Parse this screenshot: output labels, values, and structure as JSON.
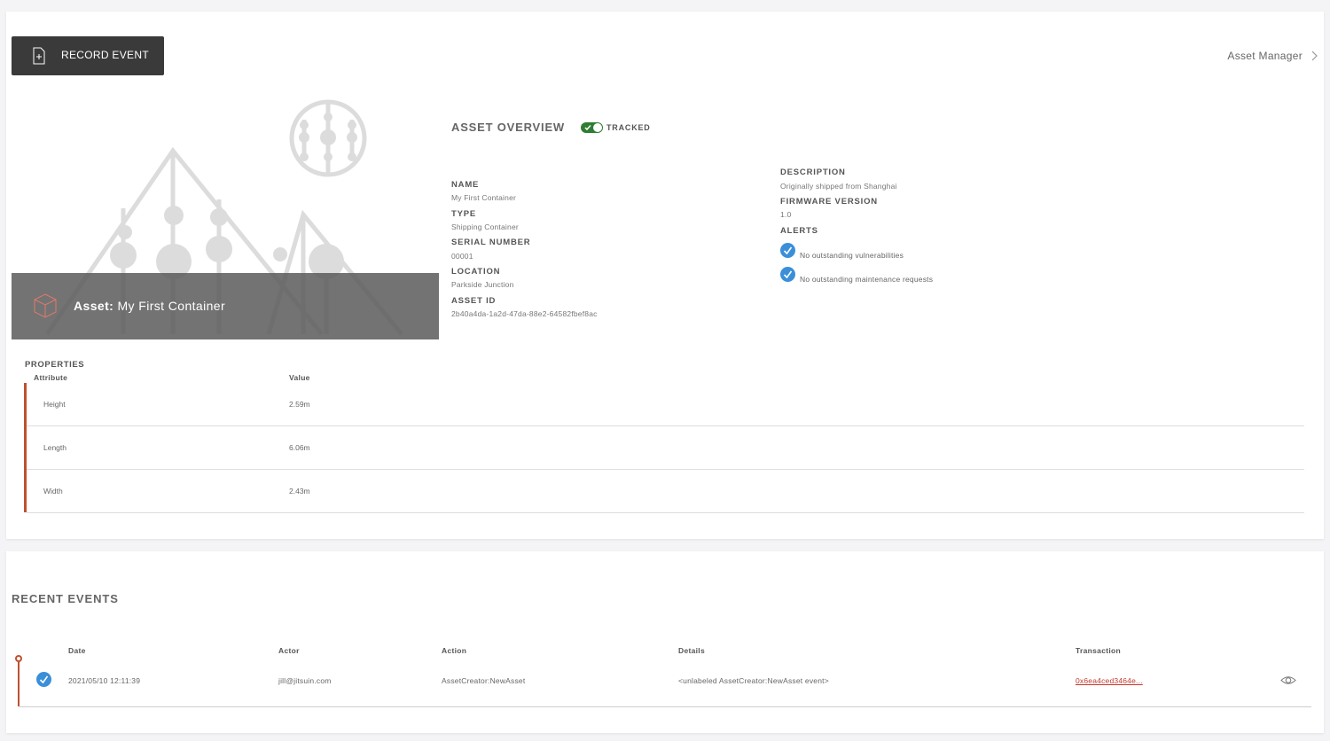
{
  "toolbar": {
    "record_label": "RECORD EVENT"
  },
  "breadcrumb": {
    "label": "Asset Manager"
  },
  "hero": {
    "prefix": "Asset:",
    "name": "My First Container"
  },
  "overview": {
    "title": "ASSET OVERVIEW",
    "status": "TRACKED",
    "fields": {
      "name_label": "NAME",
      "name_value": "My First Container",
      "type_label": "TYPE",
      "type_value": "Shipping Container",
      "serial_label": "SERIAL NUMBER",
      "serial_value": "00001",
      "location_label": "LOCATION",
      "location_value": "Parkside Junction",
      "id_label": "ASSET ID",
      "id_value": "2b40a4da-1a2d-47da-88e2-64582fbef8ac",
      "desc_label": "DESCRIPTION",
      "desc_value": "Originally shipped from Shanghai",
      "fw_label": "FIRMWARE VERSION",
      "fw_value": "1.0",
      "alerts_label": "ALERTS"
    },
    "alerts": [
      "No outstanding vulnerabilities",
      "No outstanding maintenance requests"
    ]
  },
  "properties": {
    "title": "PROPERTIES",
    "headers": [
      "Attribute",
      "Value"
    ],
    "rows": [
      {
        "attribute": "Height",
        "value": "2.59m"
      },
      {
        "attribute": "Length",
        "value": "6.06m"
      },
      {
        "attribute": "Width",
        "value": "2.43m"
      }
    ]
  },
  "events": {
    "title": "RECENT EVENTS",
    "headers": [
      "Date",
      "Actor",
      "Action",
      "Details",
      "Transaction"
    ],
    "rows": [
      {
        "date": "2021/05/10 12:11:39",
        "actor": "jill@jitsuin.com",
        "action": "AssetCreator:NewAsset",
        "details": "<unlabeled AssetCreator:NewAsset event>",
        "transaction": "0x6ea4ced3464e..."
      }
    ]
  },
  "colors": {
    "accent": "#c0502f",
    "toggle": "#2e7d32",
    "check": "#3b8fd9",
    "button": "#3a3a3a"
  },
  "icons": [
    "document-add-icon",
    "chevron-right-icon",
    "cube-icon",
    "check-circle-icon",
    "eye-icon"
  ]
}
